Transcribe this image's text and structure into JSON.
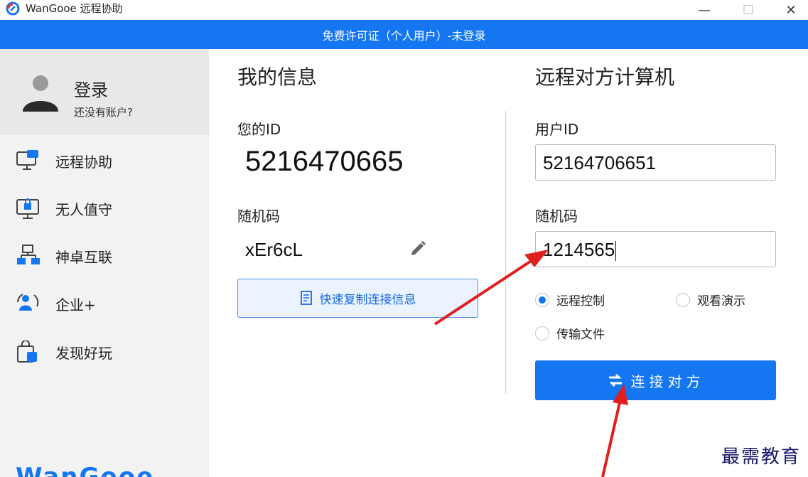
{
  "window": {
    "title": "WanGooe 远程协助",
    "minimize": "—",
    "maximize": "☐",
    "close": "✕"
  },
  "banner": {
    "text": "免费许可证（个人用户）-未登录"
  },
  "sidebar": {
    "login_label": "登录",
    "no_account": "还没有账户?",
    "items": [
      {
        "label": "远程协助",
        "icon": "remote-assist-icon"
      },
      {
        "label": "无人值守",
        "icon": "unattended-icon"
      },
      {
        "label": "神卓互联",
        "icon": "network-icon"
      },
      {
        "label": "企业+",
        "icon": "enterprise-icon"
      },
      {
        "label": "发现好玩",
        "icon": "shopping-bag-icon"
      }
    ],
    "brand": "WanGooe"
  },
  "my_info": {
    "title": "我的信息",
    "id_label": "您的ID",
    "id_value": "5216470665",
    "code_label": "随机码",
    "code_value": "xEr6cL",
    "copy_button": "快速复制连接信息"
  },
  "remote": {
    "title": "远程对方计算机",
    "user_id_label": "用户ID",
    "user_id_value": "52164706651",
    "code_label": "随机码",
    "code_value": "1214565",
    "options": [
      {
        "label": "远程控制",
        "selected": true
      },
      {
        "label": "观看演示",
        "selected": false
      },
      {
        "label": "传输文件",
        "selected": false
      }
    ],
    "connect_button": "连接对方"
  },
  "watermark": "最需教育",
  "colors": {
    "accent": "#1476f0",
    "annotation_arrow": "#e02020"
  }
}
